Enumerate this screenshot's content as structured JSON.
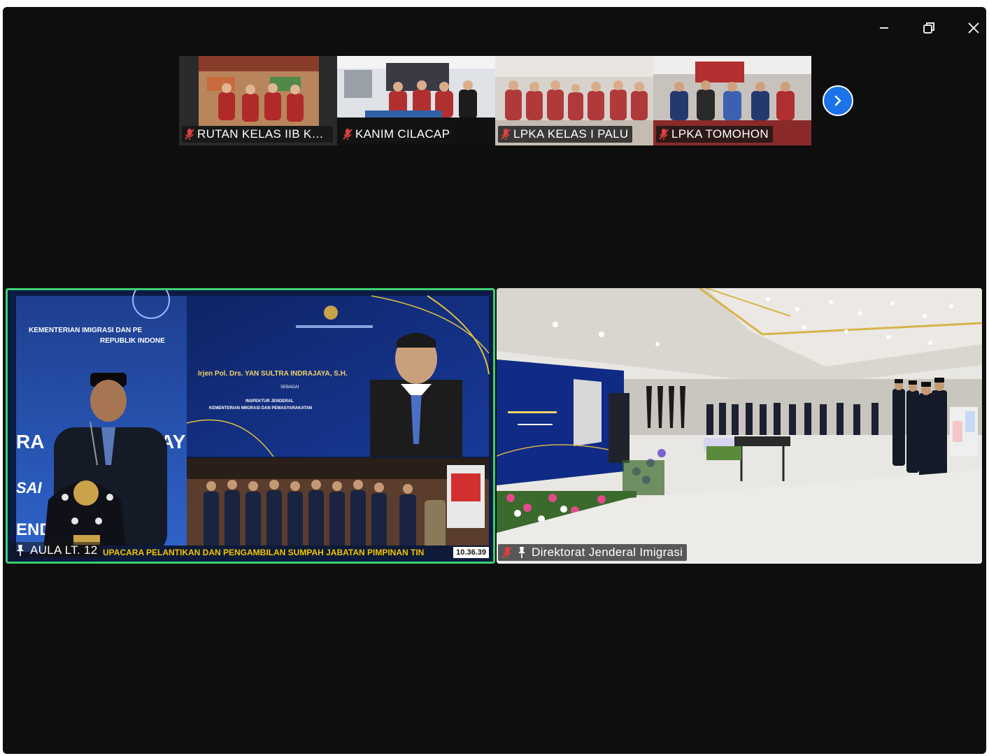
{
  "window_controls": {
    "minimize_icon": "minimize-icon",
    "restore_icon": "restore-icon",
    "close_icon": "close-icon"
  },
  "participants_strip": [
    {
      "name": "RUTAN KELAS IIB KU...",
      "muted": true
    },
    {
      "name": "KANIM CILACAP",
      "muted": true
    },
    {
      "name": "LPKA KELAS I PALU",
      "muted": true,
      "active_speaker": true
    },
    {
      "name": "LPKA TOMOHON",
      "muted": true
    }
  ],
  "next_page_icon": "chevron-right-icon",
  "main_tiles": {
    "left": {
      "name": "AULA LT. 12",
      "pinned": true,
      "highlighted": true,
      "ticker_text": "UPACARA PELANTIKAN DAN PENGAMBILAN SUMPAH JABATAN PIMPINAN TIN",
      "clock": "10.36.39",
      "screen_heading_line1": "KEMENTERIAN IMIGRASI DAN PE",
      "screen_heading_line2": "REPUBLIK INDONE",
      "slide_name": "Irjen Pol. Drs. YAN SULTRA INDRAJAYA, S.H.",
      "slide_sebagai": "SEBAGAI",
      "slide_position_line1": "INSPEKTUR JENDERAL",
      "slide_position_line2": "KEMENTERIAN IMIGRASI DAN PEMASYARAKATAN"
    },
    "right": {
      "name": "Direktorat Jenderal Imigrasi",
      "muted": true,
      "pinned": true
    }
  },
  "colors": {
    "active_border": "#3bd16f",
    "speaker_bar": "#d43232",
    "next_button": "#1a73e8",
    "ticker_text": "#f2c500",
    "background": "#0e0e0e"
  }
}
